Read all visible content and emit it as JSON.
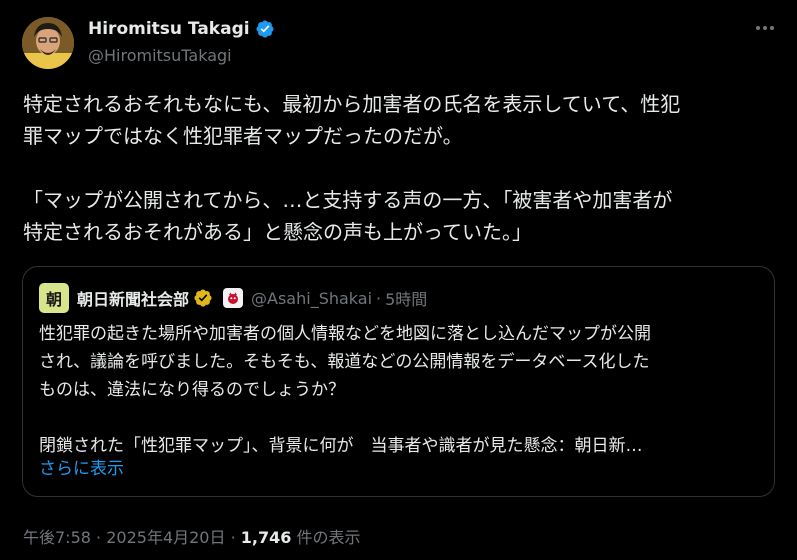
{
  "tweet": {
    "author_name": "Hiromitsu Takagi",
    "author_handle": "@HiromitsuTakagi",
    "text": "特定されるおそれもなにも、最初から加害者の氏名を表示していて、性犯\n罪マップではなく性犯罪者マップだったのだが。\n\n「マップが公開されてから、…と支持する声の一方、「被害者や加害者が\n特定されるおそれがある」と懸念の声も上がっていた。」",
    "time": "午後7:58",
    "date": "2025年4月20日",
    "views_count": "1,746",
    "views_label": "件の表示",
    "separator": "·"
  },
  "quote": {
    "avatar_char": "朝",
    "author_name": "朝日新聞社会部",
    "author_handle": "@Asahi_Shakai",
    "separator": "·",
    "time": "5時間",
    "text": "性犯罪の起きた場所や加害者の個人情報などを地図に落とし込んだマップが公開\nされ、議論を呼びました。そもそも、報道などの公開情報をデータベース化した\nものは、違法になり得るのでしょうか？\n\n閉鎖された「性犯罪マップ」、背景に何が　当事者や識者が見た懸念：朝日新…",
    "show_more": "さらに表示"
  },
  "colors": {
    "background": "#000000",
    "text": "#e7e9ea",
    "secondary": "#71767b",
    "link": "#1d9bf0",
    "verified_blue": "#1d9bf0",
    "verified_gold": "#e2b719"
  },
  "icons": [
    "verified-badge-icon",
    "more-options-icon",
    "gold-verified-badge-icon",
    "affiliate-badge-icon"
  ]
}
